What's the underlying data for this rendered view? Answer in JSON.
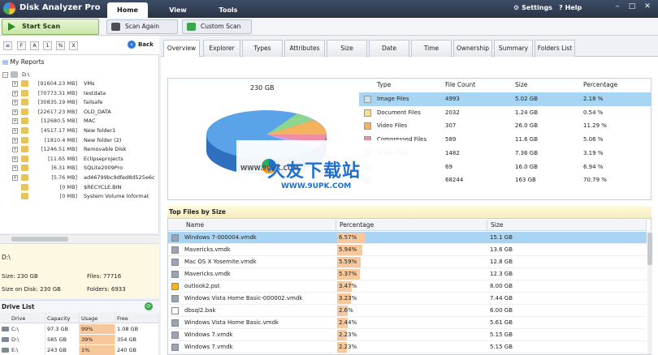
{
  "app": {
    "title": "Disk Analyzer Pro"
  },
  "menu": {
    "home": "Home",
    "view": "View",
    "tools": "Tools",
    "settings": "Settings",
    "help": "Help"
  },
  "window_controls": {
    "minimize": "–",
    "maximize": "□",
    "close": "✕"
  },
  "toolbar": {
    "start_scan": "Start Scan",
    "scan_again": "Scan Again",
    "custom_scan": "Custom Scan"
  },
  "left": {
    "filter_buttons": [
      "F",
      "A",
      "1",
      "%",
      "X"
    ],
    "back": "Back",
    "my_reports": "My Reports",
    "root": "D:\\",
    "tree": [
      {
        "size": "[91604.23 MB]",
        "name": "VMs"
      },
      {
        "size": "[70773.31 MB]",
        "name": "testdata"
      },
      {
        "size": "[30835.19 MB]",
        "name": "failsafe"
      },
      {
        "size": "[22617.23 MB]",
        "name": "OLD_DATA"
      },
      {
        "size": "[12680.5 MB]",
        "name": "MAC"
      },
      {
        "size": "[4517.17 MB]",
        "name": "New folder1"
      },
      {
        "size": "[1810.4 MB]",
        "name": "New folder (2)"
      },
      {
        "size": "[1246.51 MB]",
        "name": "Removable Disk"
      },
      {
        "size": "[11.65 MB]",
        "name": "Eclipseprojects"
      },
      {
        "size": "[6.31 MB]",
        "name": "SQLite2009Pro"
      },
      {
        "size": "[5.76 MB]",
        "name": "ad46799bc9dfed8d525e6c"
      },
      {
        "size": "[0 MB]",
        "name": "$RECYCLE.BIN"
      },
      {
        "size": "[0 MB]",
        "name": "System Volume Informat"
      }
    ]
  },
  "info": {
    "path": "D:\\",
    "size": "Size: 230 GB",
    "files": "Files: 77716",
    "size_on_disk": "Size on Disk: 230 GB",
    "folders": "Folders: 6933"
  },
  "drive_list": {
    "title": "Drive List",
    "headers": [
      "Drive",
      "Capacity",
      "Usage",
      "Free"
    ],
    "rows": [
      {
        "drive": "C:\\",
        "capacity": "97.3 GB",
        "usage": "99%",
        "free": "1.08 GB"
      },
      {
        "drive": "D:\\",
        "capacity": "585 GB",
        "usage": "39%",
        "free": "354 GB"
      },
      {
        "drive": "E:\\",
        "capacity": "243 GB",
        "usage": "1%",
        "free": "240 GB"
      }
    ]
  },
  "tabs": [
    "Overview",
    "Explorer",
    "Types",
    "Attributes",
    "Size",
    "Date",
    "Time",
    "Ownership",
    "Summary",
    "Folders List"
  ],
  "overview": {
    "pie_label": "230 GB",
    "headers": [
      "Type",
      "File Count",
      "Size",
      "Percentage"
    ],
    "rows": [
      {
        "type": "Image Files",
        "count": "4993",
        "size": "5.02 GB",
        "pct": "2.18 %",
        "color": "#bfe6f7"
      },
      {
        "type": "Document Files",
        "count": "2032",
        "size": "1.24 GB",
        "pct": "0.54 %",
        "color": "#f5e08b"
      },
      {
        "type": "Video Files",
        "count": "307",
        "size": "26.0 GB",
        "pct": "11.29 %",
        "color": "#f5b25e"
      },
      {
        "type": "Compressed Files",
        "count": "589",
        "size": "11.6 GB",
        "pct": "5.06 %",
        "color": "#f08da5"
      },
      {
        "type": "Audio Files",
        "count": "1482",
        "size": "7.36 GB",
        "pct": "3.19 %",
        "color": "#c9a6e8"
      },
      {
        "type": "",
        "count": "69",
        "size": "16.0 GB",
        "pct": "6.94 %",
        "color": "#8fd48f"
      },
      {
        "type": "",
        "count": "68244",
        "size": "163 GB",
        "pct": "70.79 %",
        "color": "#5aa3e8"
      }
    ]
  },
  "top_files": {
    "title": "Top Files by Size",
    "headers": [
      "Name",
      "Percentage",
      "Size"
    ],
    "rows": [
      {
        "name": "Windows 7-000004.vmdk",
        "pct": "6.57%",
        "pct_value": 6.57,
        "size": "15.1 GB",
        "icon": "disk-file-icon"
      },
      {
        "name": "Mavericks.vmdk",
        "pct": "5.94%",
        "pct_value": 5.94,
        "size": "13.6 GB",
        "icon": "disk-file-icon"
      },
      {
        "name": "Mac OS X Yosemite.vmdk",
        "pct": "5.59%",
        "pct_value": 5.59,
        "size": "12.8 GB",
        "icon": "disk-file-icon"
      },
      {
        "name": "Mavericks.vmdk",
        "pct": "5.37%",
        "pct_value": 5.37,
        "size": "12.3 GB",
        "icon": "disk-file-icon"
      },
      {
        "name": "outlook2.pst",
        "pct": "3.47%",
        "pct_value": 3.47,
        "size": "8.00 GB",
        "icon": "outlook-file-icon"
      },
      {
        "name": "Windows Vista Home Basic-000002.vmdk",
        "pct": "3.23%",
        "pct_value": 3.23,
        "size": "7.44 GB",
        "icon": "disk-file-icon"
      },
      {
        "name": "dbsql2.bak",
        "pct": "2.6%",
        "pct_value": 2.6,
        "size": "6.00 GB",
        "icon": "generic-file-icon"
      },
      {
        "name": "Windows Vista Home Basic.vmdk",
        "pct": "2.44%",
        "pct_value": 2.44,
        "size": "5.61 GB",
        "icon": "disk-file-icon"
      },
      {
        "name": "Windows 7.vmdk",
        "pct": "2.23%",
        "pct_value": 2.23,
        "size": "5.15 GB",
        "icon": "disk-file-icon"
      },
      {
        "name": "Windows 7.vmdk",
        "pct": "2.23%",
        "pct_value": 2.23,
        "size": "5.15 GB",
        "icon": "disk-file-icon"
      }
    ]
  },
  "watermark": {
    "cn": "久友下载站",
    "left": "WWW.9UPK.COM",
    "url": "WWW.9UPK.COM"
  }
}
